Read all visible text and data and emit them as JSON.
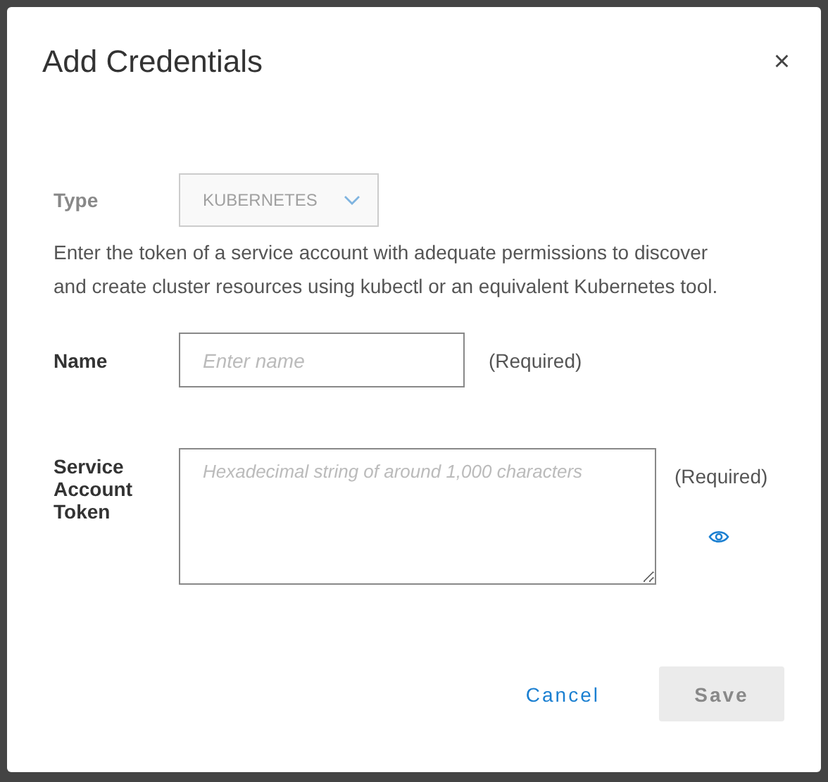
{
  "dialog": {
    "title": "Add Credentials",
    "close": "×"
  },
  "type_field": {
    "label": "Type",
    "value": "KUBERNETES",
    "disabled": true
  },
  "description": "Enter the token of a service account with adequate permissions to discover and create cluster resources using kubectl or an equivalent Kubernetes tool.",
  "name_field": {
    "label": "Name",
    "placeholder": "Enter name",
    "note": "(Required)"
  },
  "token_field": {
    "label": "Service Account Token",
    "placeholder": "Hexadecimal string of around 1,000 characters",
    "note": "(Required)"
  },
  "buttons": [
    {
      "label": "Cancel",
      "kind": "link",
      "disabled": false
    },
    {
      "label": "Save",
      "kind": "primary",
      "disabled": true
    }
  ]
}
